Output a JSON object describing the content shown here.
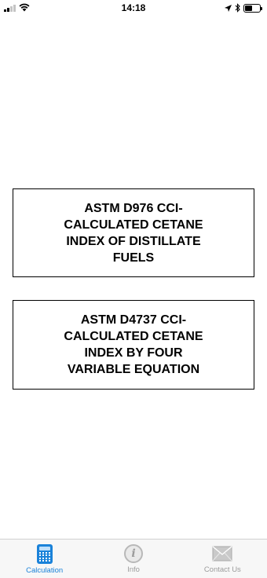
{
  "status_bar": {
    "time": "14:18"
  },
  "cards": [
    {
      "label": "ASTM D976 CCI-CALCULATED CETANE INDEX OF DISTILLATE FUELS"
    },
    {
      "label": "ASTM D4737 CCI-CALCULATED CETANE INDEX BY FOUR VARIABLE EQUATION"
    }
  ],
  "tab_bar": {
    "tabs": [
      {
        "label": "Calculation",
        "icon": "calculator-icon",
        "active": true
      },
      {
        "label": "Info",
        "icon": "info-icon",
        "active": false
      },
      {
        "label": "Contact Us",
        "icon": "mail-icon",
        "active": false
      }
    ]
  },
  "colors": {
    "accent": "#1a82d9",
    "inactive": "#9b9b9b",
    "tab_bar_bg": "#f7f7f7"
  }
}
